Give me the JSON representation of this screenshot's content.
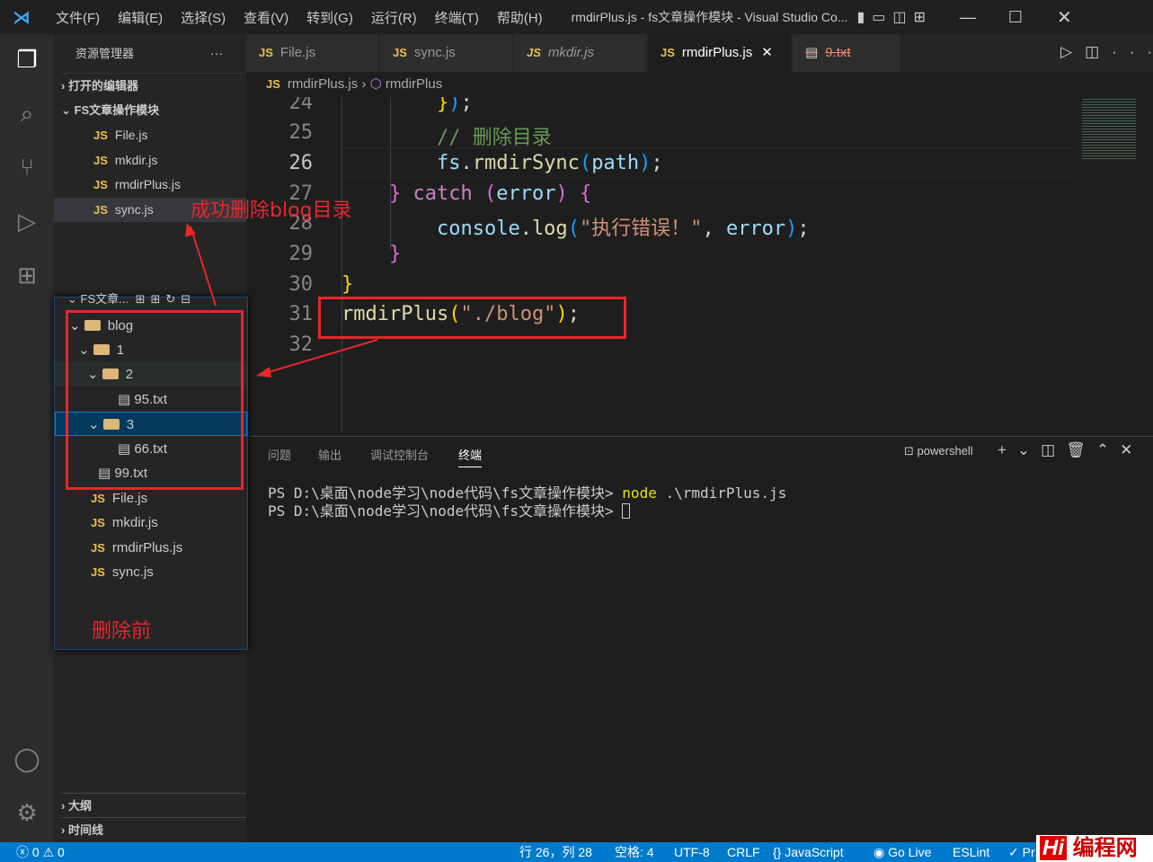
{
  "titlebar": {
    "menus": [
      "文件(F)",
      "编辑(E)",
      "选择(S)",
      "查看(V)",
      "转到(G)",
      "运行(R)",
      "终端(T)",
      "帮助(H)"
    ],
    "title": "rmdirPlus.js - fs文章操作模块 - Visual Studio Co..."
  },
  "sidebar": {
    "title": "资源管理器",
    "open_editors": "打开的编辑器",
    "folder": "FS文章操作模块",
    "files": [
      "File.js",
      "mkdir.js",
      "rmdirPlus.js",
      "sync.js"
    ],
    "outline": "大纲",
    "timeline": "时间线"
  },
  "tabs": [
    {
      "label": "File.js"
    },
    {
      "label": "sync.js"
    },
    {
      "label": "mkdir.js"
    },
    {
      "label": "rmdirPlus.js"
    },
    {
      "label": "9.txt"
    }
  ],
  "js_badge": "JS",
  "breadcrumb": {
    "file": "rmdirPlus.js",
    "symbol": "rmdirPlus"
  },
  "code": {
    "line_numbers": [
      "24",
      "25",
      "26",
      "27",
      "28",
      "29",
      "30",
      "31",
      "32"
    ],
    "current_line": "26"
  },
  "panel": {
    "tabs": [
      "问题",
      "输出",
      "调试控制台",
      "终端"
    ],
    "shell": "powershell",
    "terminal_lines": [
      {
        "prompt": "PS D:\\桌面\\node学习\\node代码\\fs文章操作模块> ",
        "cmd": "node",
        "arg": " .\\rmdirPlus.js"
      },
      {
        "prompt": "PS D:\\桌面\\node学习\\node代码\\fs文章操作模块> ",
        "cmd": "",
        "arg": ""
      }
    ]
  },
  "popup": {
    "header": "FS文章...",
    "tree": [
      "blog",
      "1",
      "2",
      "95.txt",
      "3",
      "66.txt",
      "99.txt",
      "File.js",
      "mkdir.js",
      "rmdirPlus.js",
      "sync.js"
    ]
  },
  "annotations": {
    "success": "成功删除blog目录",
    "before": "删除前"
  },
  "statusbar": {
    "errors": "0",
    "warnings": "0",
    "position": "行 26，列 28",
    "spaces": "空格: 4",
    "encoding": "UTF-8",
    "eol": "CRLF",
    "language": "JavaScript",
    "golive": "Go Live",
    "eslint": "ESLint",
    "prettier": "Pr"
  },
  "watermark": "编程网",
  "colors": {
    "accent": "#007acc",
    "annotation": "#e8262b"
  }
}
